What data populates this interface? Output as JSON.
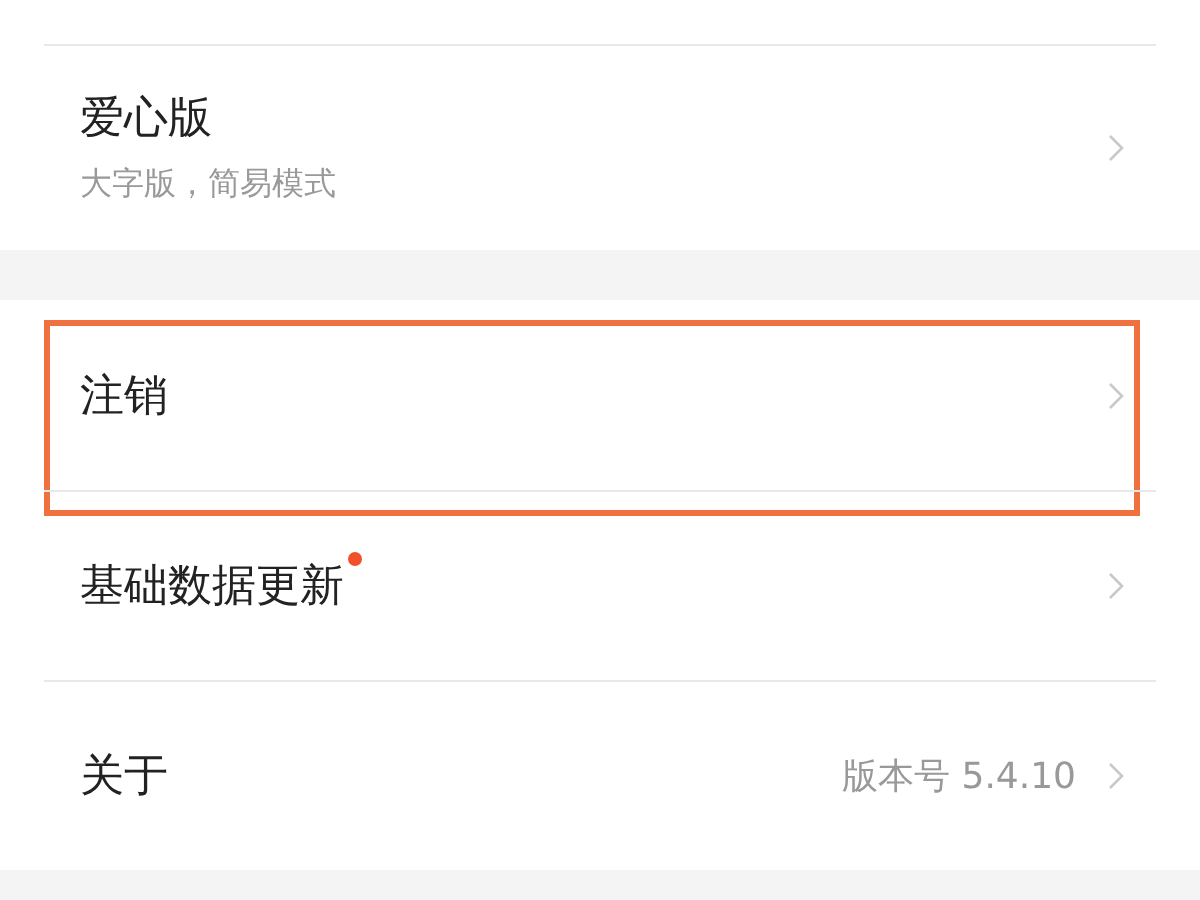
{
  "groups": [
    {
      "items": [
        {
          "title": "爱心版",
          "subtitle": "大字版，简易模式",
          "highlighted": false,
          "badge": false
        }
      ]
    },
    {
      "items": [
        {
          "title": "注销",
          "highlighted": true,
          "badge": false
        },
        {
          "title": "基础数据更新",
          "highlighted": false,
          "badge": true
        },
        {
          "title": "关于",
          "value": "版本号 5.4.10",
          "highlighted": false,
          "badge": false
        }
      ]
    }
  ]
}
